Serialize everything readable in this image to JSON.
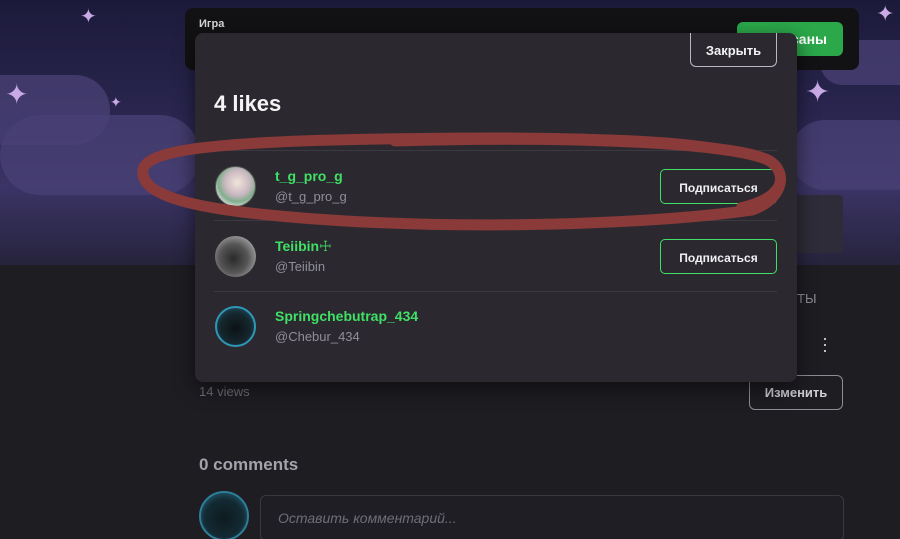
{
  "background": {
    "game_label": "Игра",
    "subscribed_label": "саны",
    "side_text": "ТЫ",
    "views": "14 views",
    "edit_label": "Изменить",
    "comments_title": "0 comments",
    "comment_placeholder": "Оставить комментарий..."
  },
  "modal": {
    "close_label": "Закрыть",
    "title": "4 likes",
    "users": [
      {
        "name": "t_g_pro_g",
        "handle": "@t_g_pro_g",
        "follow_label": "Подписаться"
      },
      {
        "name": "Teiibin☩",
        "handle": "@Teiibin",
        "follow_label": "Подписаться"
      },
      {
        "name": "Springchebutrap_434",
        "handle": "@Chebur_434"
      }
    ]
  },
  "colors": {
    "accent_green": "#3fe065",
    "annotation_red": "#8a3a38",
    "modal_bg": "#2b292f"
  },
  "icons": {
    "kebab": "more-vertical-icon",
    "stars": "sparkle-icon"
  }
}
